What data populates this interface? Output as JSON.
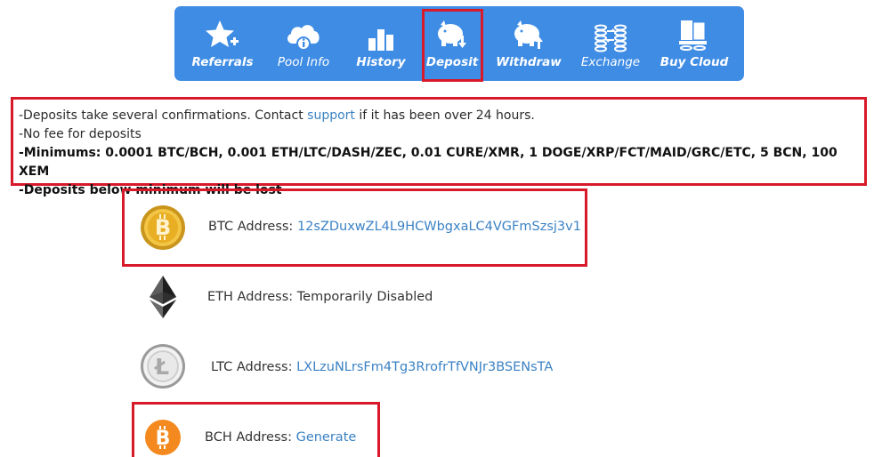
{
  "nav": [
    {
      "key": "referrals",
      "label": "Referrals",
      "icon": "star-plus-icon"
    },
    {
      "key": "pool_info",
      "label": "Pool Info",
      "icon": "cloud-info-icon"
    },
    {
      "key": "history",
      "label": "History",
      "icon": "bar-chart-icon"
    },
    {
      "key": "deposit",
      "label": "Deposit",
      "icon": "piggy-bank-down-icon",
      "active": true
    },
    {
      "key": "withdraw",
      "label": "Withdraw",
      "icon": "piggy-bank-up-icon"
    },
    {
      "key": "exchange",
      "label": "Exchange",
      "icon": "coin-stacks-exchange-icon"
    },
    {
      "key": "buy_cloud",
      "label": "Buy Cloud",
      "icon": "server-cloud-icon"
    }
  ],
  "notice": {
    "line1_prefix": "-Deposits take several confirmations. Contact ",
    "line1_link": "support",
    "line1_suffix": " if it has been over 24 hours.",
    "line2": "-No fee for deposits",
    "line3": "-Minimums: 0.0001 BTC/BCH, 0.001 ETH/LTC/DASH/ZEC, 0.01 CURE/XMR, 1 DOGE/XRP/FCT/MAID/GRC/ETC, 5 BCN, 100 XEM",
    "line4": "-Deposits below minimum will be lost"
  },
  "addresses": {
    "btc": {
      "label": "BTC Address: ",
      "value": "12sZDuxwZL4L9HCWbgxaLC4VGFmSzsj3v1",
      "icon": "bitcoin-coin-icon"
    },
    "eth": {
      "label": "ETH Address: ",
      "value": "Temporarily Disabled",
      "icon": "ethereum-icon"
    },
    "ltc": {
      "label": "LTC Address: ",
      "value": "LXLzuNLrsFm4Tg3RrofrTfVNJr3BSENsTA",
      "icon": "litecoin-icon"
    },
    "bch": {
      "label": "BCH Address: ",
      "value": "Generate",
      "icon": "bitcoin-cash-icon"
    }
  },
  "colors": {
    "nav_bg": "#3f8ce4",
    "highlight": "#d8192a",
    "link": "#3b82c4"
  }
}
